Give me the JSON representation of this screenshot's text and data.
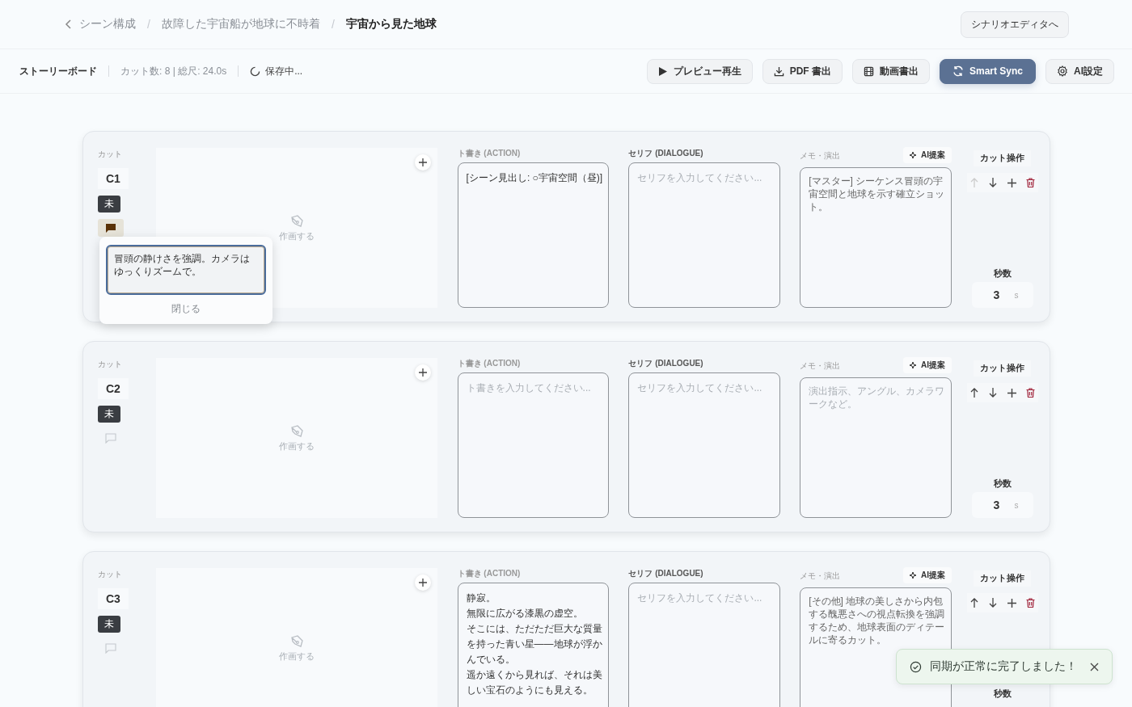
{
  "breadcrumb": [
    {
      "label": "シーン構成",
      "current": false
    },
    {
      "separator": "/",
      "label": "故障した宇宙船が地球に不時着",
      "current": false
    },
    {
      "separator": "/",
      "label": "宇宙から見た地球",
      "current": true
    }
  ],
  "header_button": "シナリオエディタへ",
  "toolbar": {
    "title": "ストーリーボード",
    "stats": "カット数: 8 | 総尺: 24.0s",
    "save_status": "保存中...",
    "buttons": [
      {
        "kind": "play",
        "label": "プレビュー再生",
        "primary": false
      },
      {
        "kind": "download",
        "label": "PDF 書出",
        "primary": false
      },
      {
        "kind": "film",
        "label": "動画書出",
        "primary": false
      },
      {
        "kind": "sync",
        "label": "Smart Sync",
        "primary": true
      },
      {
        "kind": "gear",
        "label": "AI設定",
        "primary": false
      }
    ]
  },
  "cuts": [
    {
      "cut_label": "カット",
      "id": "C1",
      "status": "未",
      "has_note": true,
      "draw_label": "作画する",
      "action": {
        "label": "ト書き (ACTION)",
        "value": "[シーン見出し: ○宇宙空間（昼)]"
      },
      "dialogue": {
        "label": "セリフ (DIALOGUE)",
        "placeholder": "セリフを入力してください..."
      },
      "memo": {
        "label": "メモ・演出",
        "ai_button": "AI提案",
        "value": "[マスター] シーケンス冒頭の宇宙空間と地球を示す確立ショット。"
      },
      "ops_label": "カット操作",
      "can_move_up": false,
      "seconds_label": "秒数",
      "seconds": "3",
      "seconds_unit": "s"
    },
    {
      "cut_label": "カット",
      "id": "C2",
      "status": "未",
      "has_note": false,
      "draw_label": "作画する",
      "action": {
        "label": "ト書き (ACTION)",
        "placeholder": "ト書きを入力してください..."
      },
      "dialogue": {
        "label": "セリフ (DIALOGUE)",
        "placeholder": "セリフを入力してください..."
      },
      "memo": {
        "label": "メモ・演出",
        "ai_button": "AI提案",
        "placeholder": "演出指示、アングル、カメラワークなど。"
      },
      "ops_label": "カット操作",
      "can_move_up": true,
      "seconds_label": "秒数",
      "seconds": "3",
      "seconds_unit": "s"
    },
    {
      "cut_label": "カット",
      "id": "C3",
      "status": "未",
      "has_note": false,
      "draw_label": "作画する",
      "action": {
        "label": "ト書き (ACTION)",
        "lines": [
          "静寂。",
          "無限に広がる漆黒の虚空。",
          "そこには、ただただ巨大な質量を持った青い星——地球が浮かんでいる。",
          "遥か遠くから見れば、それは美しい宝石のようにも見える。"
        ]
      },
      "dialogue": {
        "label": "セリフ (DIALOGUE)",
        "placeholder": "セリフを入力してください..."
      },
      "memo": {
        "label": "メモ・演出",
        "ai_button": "AI提案",
        "value": "[その他] 地球の美しさから内包する醜悪さへの視点転換を強調するため、地球表面のディテールに寄るカット。"
      },
      "ops_label": "カット操作",
      "can_move_up": true,
      "seconds_label": "秒数"
    }
  ],
  "note_popover": {
    "value": "冒頭の静けさを強調。カメラはゆっくりズームで。",
    "close": "閉じる"
  },
  "toast": {
    "message": "同期が正常に完了しました！"
  }
}
